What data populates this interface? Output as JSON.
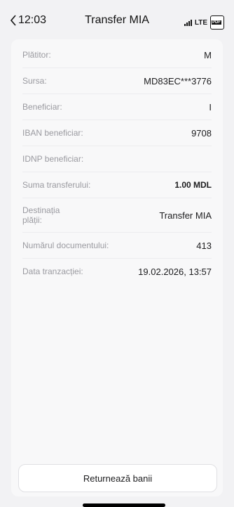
{
  "status_bar": {
    "time": "12:03",
    "network": "LTE",
    "pdf_label": "PDF"
  },
  "header": {
    "title": "Transfer MIA"
  },
  "details": [
    {
      "label": "Plătitor:",
      "value": "M"
    },
    {
      "label": "Sursa:",
      "value": "MD83EC***3776"
    },
    {
      "label": "Beneficiar:",
      "value": "I"
    },
    {
      "label": "IBAN beneficiar:",
      "value": "9708"
    },
    {
      "label": "IDNP beneficiar:",
      "value": ""
    },
    {
      "label": "Suma transferului:",
      "value": "1.00 MDL"
    },
    {
      "label": "Destinația plății:",
      "value": "Transfer MIA"
    },
    {
      "label": "Numărul documentului:",
      "value": "413"
    },
    {
      "label": "Data tranzacției:",
      "value": "19.02.2026, 13:57"
    }
  ],
  "actions": {
    "return_label": "Returnează banii"
  }
}
